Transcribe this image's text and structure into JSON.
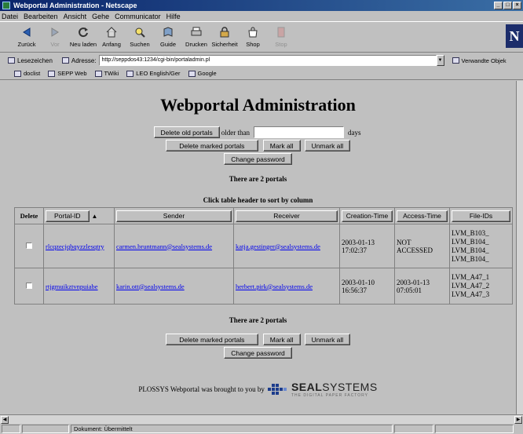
{
  "window": {
    "title": "Webportal Administration - Netscape"
  },
  "menu": [
    "Datei",
    "Bearbeiten",
    "Ansicht",
    "Gehe",
    "Communicator",
    "Hilfe"
  ],
  "toolbar": [
    {
      "label": "Zurück",
      "icon": "back-arrow-icon",
      "disabled": false
    },
    {
      "label": "Vor",
      "icon": "forward-arrow-icon",
      "disabled": true
    },
    {
      "label": "Neu laden",
      "icon": "reload-icon",
      "disabled": false
    },
    {
      "label": "Anfang",
      "icon": "home-icon",
      "disabled": false
    },
    {
      "label": "Suchen",
      "icon": "search-icon",
      "disabled": false
    },
    {
      "label": "Guide",
      "icon": "guide-icon",
      "disabled": false
    },
    {
      "label": "Drucken",
      "icon": "print-icon",
      "disabled": false
    },
    {
      "label": "Sicherheit",
      "icon": "lock-icon",
      "disabled": false
    },
    {
      "label": "Shop",
      "icon": "shop-icon",
      "disabled": false
    },
    {
      "label": "Stop",
      "icon": "stop-icon",
      "disabled": true
    }
  ],
  "location": {
    "bookmarks_label": "Lesezeichen",
    "address_label": "Adresse:",
    "url": "http://seppdos43:1234/cgi-bin/portaladmin.pl",
    "related_label": "Verwandte Objek"
  },
  "personal_toolbar": [
    "doclist",
    "SEPP Web",
    "TWiki",
    "LEO English/Ger",
    "Google"
  ],
  "page": {
    "title": "Webportal Administration",
    "delete_old_label": "Delete old portals",
    "older_than_label": "older than",
    "days_label": "days",
    "days_value": "",
    "delete_marked_label": "Delete marked portals",
    "mark_all_label": "Mark all",
    "unmark_all_label": "Unmark all",
    "change_password_label": "Change password",
    "portal_count_text": "There are 2 portals",
    "sort_hint": "Click table header to sort by column",
    "columns": {
      "delete": "Delete",
      "portal_id": "Portal-ID",
      "sort_indicator": "▲",
      "sender": "Sender",
      "receiver": "Receiver",
      "creation_time": "Creation-Time",
      "access_time": "Access-Time",
      "file_ids": "File-IDs"
    },
    "rows": [
      {
        "portal_id": "rlcqzecjqbqyzzlesqtry",
        "sender": "carmen.bruntmann@sealsystems.de",
        "receiver": "katja.gestinger@sealsystems.de",
        "creation_date": "2003-01-13",
        "creation_time": "17:02:37",
        "access_line1": "NOT",
        "access_line2": "ACCESSED",
        "file_ids": [
          "LVM_B103_",
          "LVM_B104_",
          "LVM_B104_",
          "LVM_B104_"
        ]
      },
      {
        "portal_id": "rtjgmuikztvnpuiabe",
        "sender": "karin.ott@sealsystems.de",
        "receiver": "herbert.pirk@sealsystems.de",
        "creation_date": "2003-01-10",
        "creation_time": "16:56:37",
        "access_line1": "2003-01-13",
        "access_line2": "07:05:01",
        "file_ids": [
          "LVM_A47_1",
          "LVM_A47_2",
          "LVM_A47_3"
        ]
      }
    ],
    "footer_text": "PLOSSYS Webportal was brought to you by",
    "seal_bold": "SEAL",
    "seal_rest": "SYSTEMS",
    "seal_tagline": "THE DIGITAL PAPER FACTORY"
  },
  "status": {
    "text": "Dokument: Übermittelt"
  }
}
